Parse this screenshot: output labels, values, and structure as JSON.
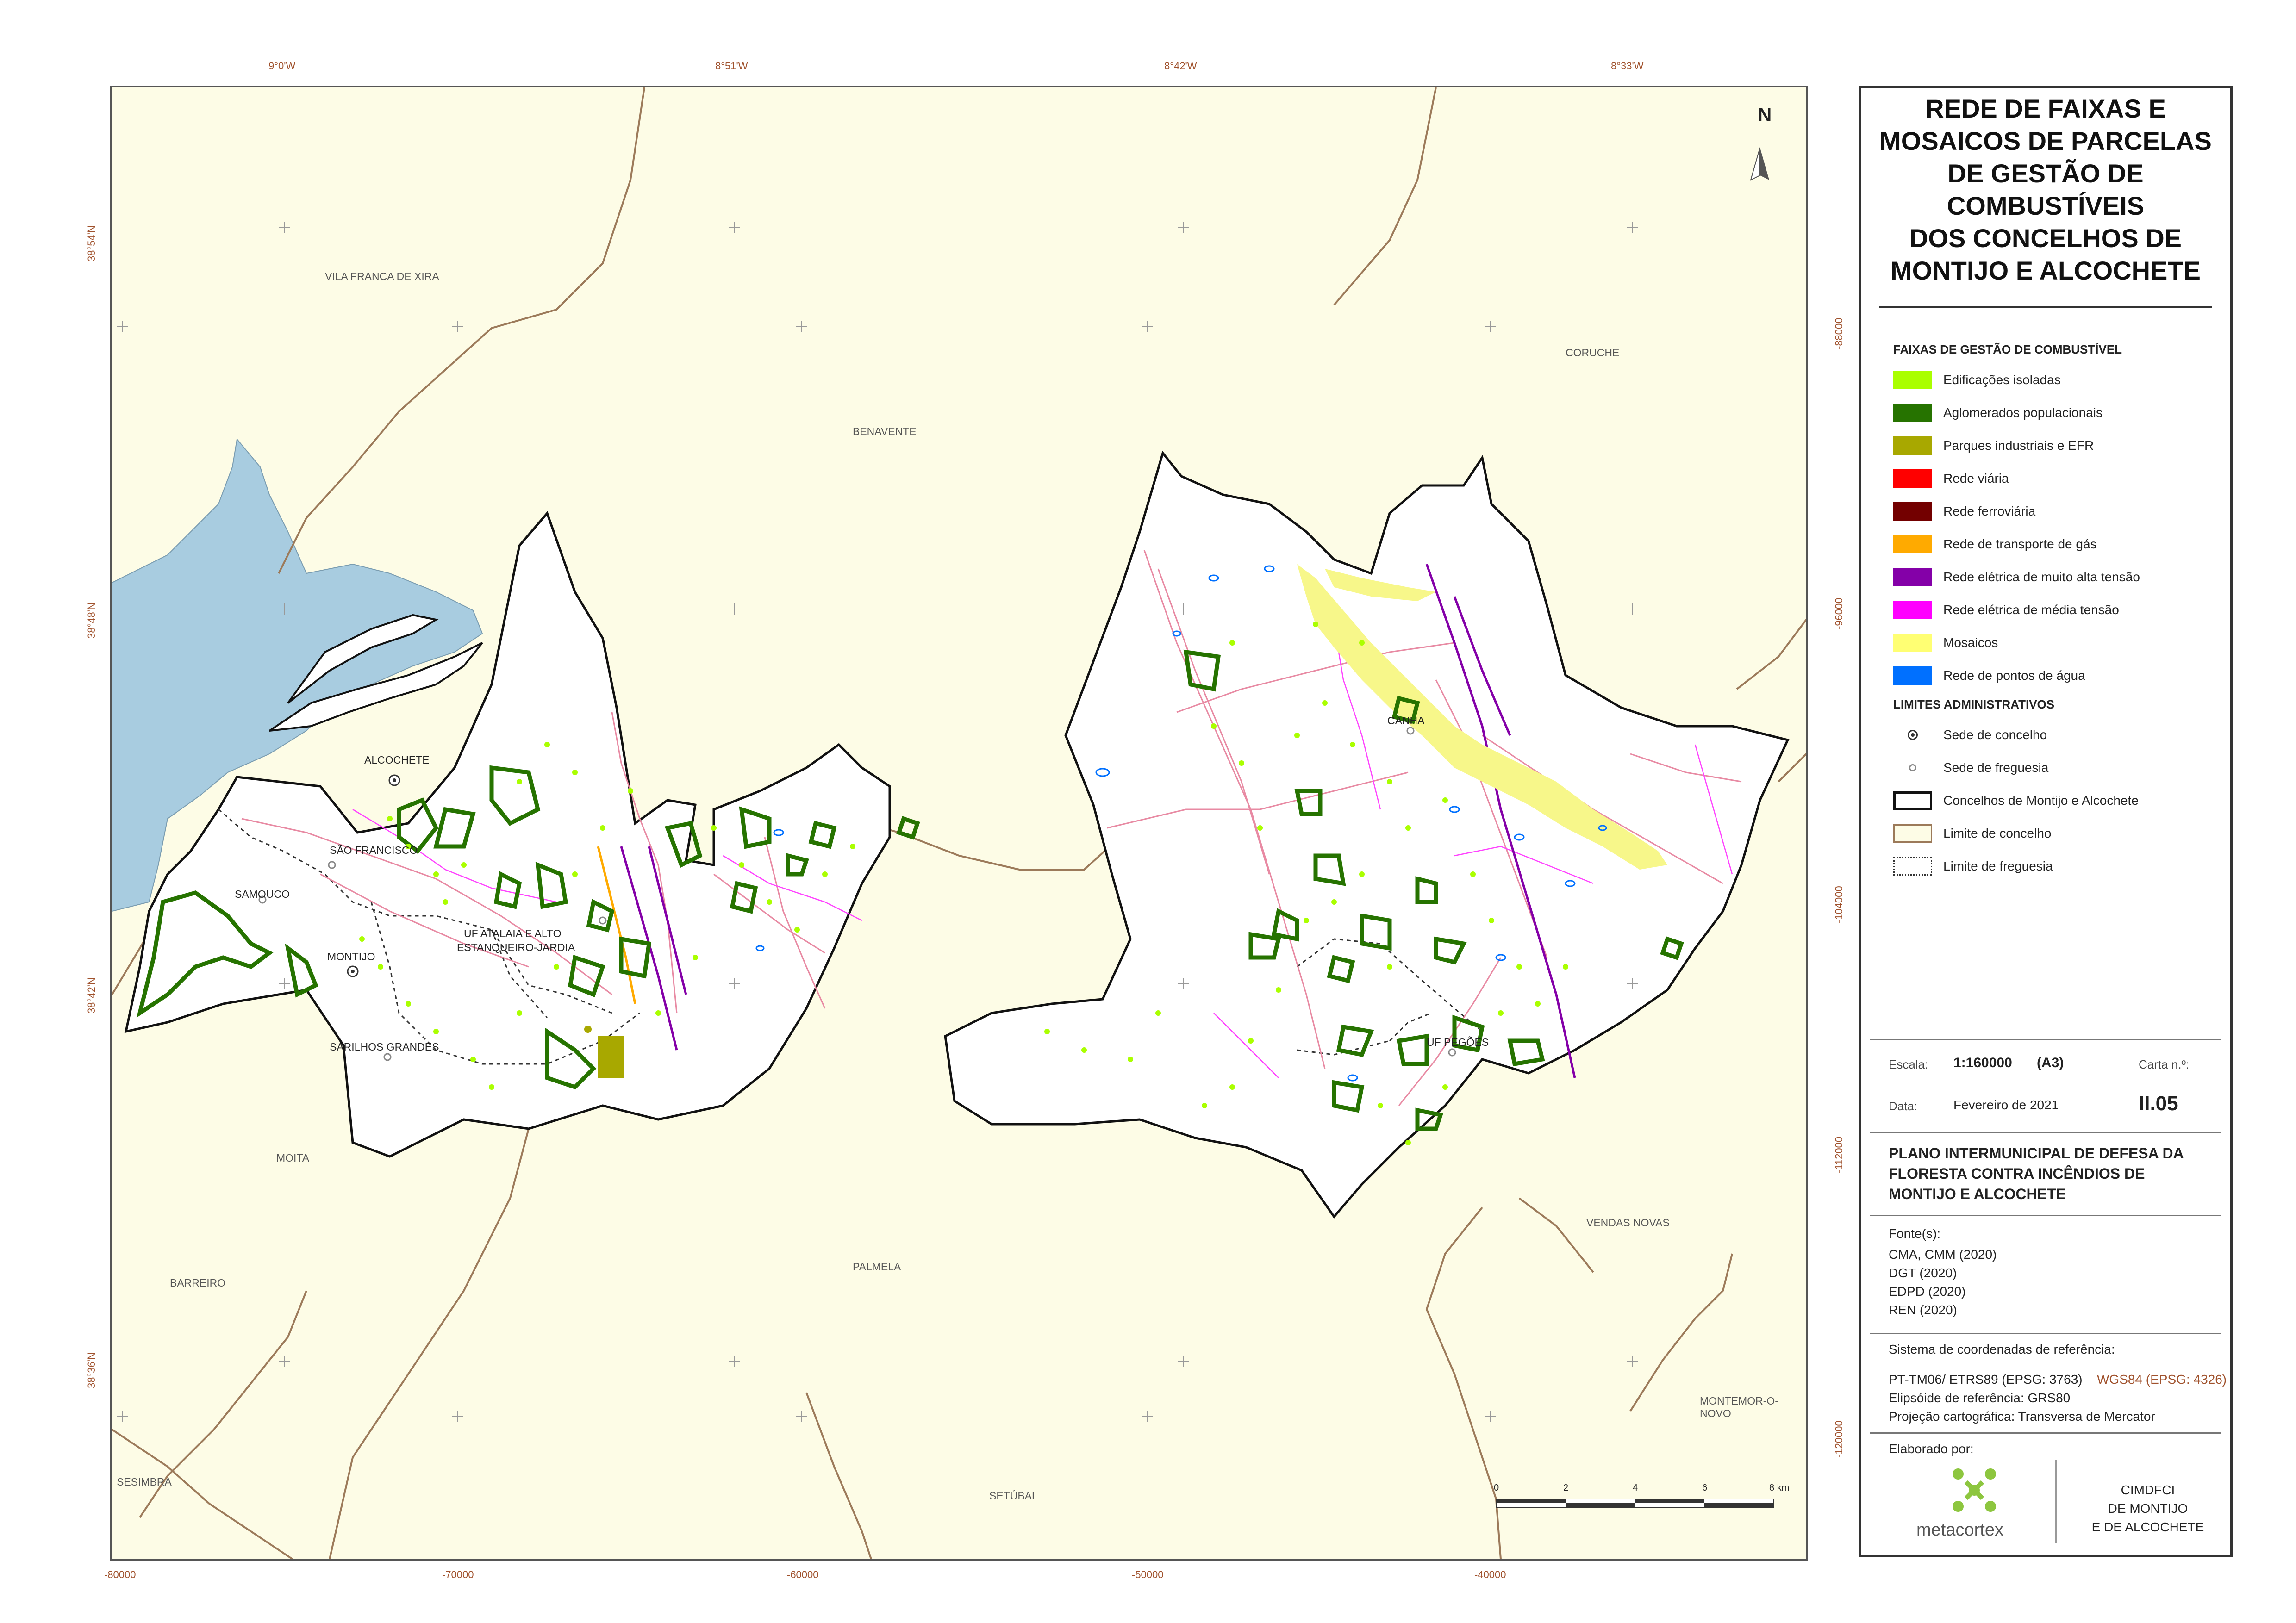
{
  "map": {
    "top_longitude_labels": [
      "9°0'W",
      "8°51'W",
      "8°42'W",
      "8°33'W"
    ],
    "left_latitude_labels": [
      "38°54'N",
      "38°48'N",
      "38°42'N",
      "38°36'N"
    ],
    "right_northing_labels": [
      "-88000",
      "-96000",
      "-104000",
      "-112000",
      "-120000"
    ],
    "bottom_easting_labels": [
      "-80000",
      "-70000",
      "-60000",
      "-50000",
      "-40000"
    ],
    "place_labels": {
      "vila_franca_de_xira": "VILA FRANCA DE XIRA",
      "benavente": "BENAVENTE",
      "coruche": "CORUCHE",
      "alcochete": "ALCOCHETE",
      "sao_francisco": "SÃO FRANCISCO",
      "samouco": "SAMOUCO",
      "montijo": "MONTIJO",
      "uf_atalaia_1": "UF ATALAIA E ALTO",
      "uf_atalaia_2": "ESTANQUEIRO-JARDIA",
      "sarilhos_grandes": "SARILHOS GRANDES",
      "moita": "MOITA",
      "barreiro": "BARREIRO",
      "palmela": "PALMELA",
      "sesimbra": "SESIMBRA",
      "setubal": "SETÚBAL",
      "canha": "CANHA",
      "uf_pegoes": "UF PEGÕES",
      "vendas_novas": "VENDAS NOVAS",
      "montemor_o_novo": "MONTEMOR-O-NOVO"
    },
    "north_arrow": "N",
    "scale_ticks": [
      "0",
      "2",
      "4",
      "6",
      "8 km"
    ]
  },
  "panel": {
    "title_lines": [
      "REDE DE FAIXAS E",
      "MOSAICOS DE PARCELAS",
      "DE GESTÃO DE",
      "COMBUSTÍVEIS",
      "DOS CONCELHOS DE",
      "MONTIJO E ALCOCHETE"
    ],
    "legend_faixas_head": "FAIXAS DE GESTÃO DE COMBUSTÍVEL",
    "legend_faixas": [
      {
        "label": "Edificações isoladas",
        "color": "#aaff00"
      },
      {
        "label": "Aglomerados populacionais",
        "color": "#267300"
      },
      {
        "label": "Parques industriais e EFR",
        "color": "#a8a800"
      },
      {
        "label": "Rede viária",
        "color": "#ff0000"
      },
      {
        "label": "Rede ferroviária",
        "color": "#730000"
      },
      {
        "label": "Rede de transporte de gás",
        "color": "#ffaa00"
      },
      {
        "label": "Rede elétrica de muito alta tensão",
        "color": "#8400a8"
      },
      {
        "label": "Rede elétrica de média tensão",
        "color": "#ff00ff"
      },
      {
        "label": "Mosaicos",
        "color": "#ffff73"
      },
      {
        "label": "Rede de pontos de água",
        "color": "#0070ff"
      }
    ],
    "legend_admin_head": "LIMITES ADMINISTRATIVOS",
    "legend_admin": [
      {
        "label": "Sede de concelho"
      },
      {
        "label": "Sede de freguesia"
      },
      {
        "label": "Concelhos de Montijo e Alcochete"
      },
      {
        "label": "Limite de concelho"
      },
      {
        "label": "Limite de freguesia"
      }
    ],
    "escala_label": "Escala:",
    "escala_value": "1:160000",
    "escala_format": "(A3)",
    "carta_label": "Carta n.º:",
    "carta_value": "II.05",
    "data_label": "Data:",
    "data_value": "Fevereiro de 2021",
    "plano_lines": [
      "PLANO INTERMUNICIPAL DE DEFESA DA",
      "FLORESTA CONTRA INCÊNDIOS DE",
      "MONTIJO E ALCOCHETE"
    ],
    "fontes_label": "Fonte(s):",
    "fontes": [
      "CMA, CMM (2020)",
      "DGT (2020)",
      "EDPD (2020)",
      "REN (2020)"
    ],
    "sistema_label": "Sistema de coordenadas de referência:",
    "sistema_value": "PT-TM06/ ETRS89 (EPSG: 3763)",
    "sistema_value2": "WGS84 (EPSG: 4326)",
    "elipsoide": "Elipsóide de referência: GRS80",
    "projecao": "Projeção cartográfica: Transversa de Mercator",
    "elaborado_label": "Elaborado por:",
    "logo_text": "metacortex",
    "client_lines": [
      "CIMDFCI",
      "DE MONTIJO",
      "E DE ALCOCHETE"
    ]
  }
}
